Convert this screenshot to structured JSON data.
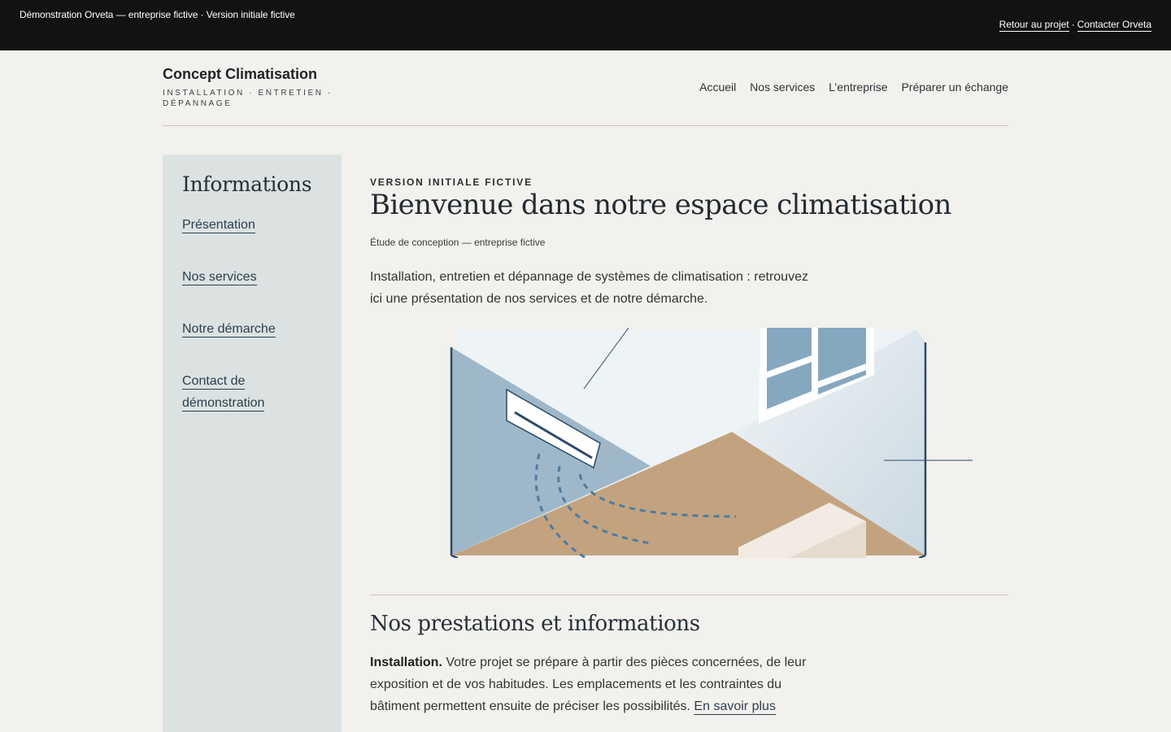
{
  "topbar": {
    "left_text": "Démonstration Orveta — entreprise fictive · Version initiale fictive",
    "back_link": "Retour au projet",
    "separator": "·",
    "contact_link": "Contacter Orveta"
  },
  "brand": {
    "name": "Concept Climatisation",
    "tagline": "INSTALLATION · ENTRETIEN · DÉPANNAGE"
  },
  "nav": {
    "items": [
      {
        "label": "Accueil"
      },
      {
        "label": "Nos services"
      },
      {
        "label": "L’entreprise"
      },
      {
        "label": "Préparer un échange"
      }
    ]
  },
  "sidebar": {
    "heading": "Informations",
    "items": [
      {
        "label": "Présentation"
      },
      {
        "label": "Nos services"
      },
      {
        "label": "Notre démarche"
      },
      {
        "label_line1": "Contact de",
        "label_line2": "démonstration"
      }
    ]
  },
  "main": {
    "eyebrow": "VERSION INITIALE FICTIVE",
    "title": "Bienvenue dans notre espace climatisation",
    "subline": "Étude de conception — entreprise fictive",
    "intro": "Installation, entretien et dépannage de systèmes de climatisation : retrouvez ici une présentation de nos services et de notre démarche."
  },
  "section": {
    "title": "Nos prestations et informations",
    "lead": "Installation.",
    "body": " Votre projet se prépare à partir des pièces concernées, de leur exposition et de vos habitudes. Les emplacements et les contraintes du bâtiment permettent ensuite de préciser les possibilités. ",
    "more_link": "En savoir plus"
  },
  "colors": {
    "topbar": "#141210",
    "page_bg": "#f3f1ed",
    "sidebar_bg": "#dbe2e1",
    "accent_blue": "#2c4a66",
    "floor": "#c3a37f"
  },
  "illustration": {
    "icons": [
      "air-conditioner-icon",
      "window-icon",
      "air-flow-icon"
    ]
  }
}
